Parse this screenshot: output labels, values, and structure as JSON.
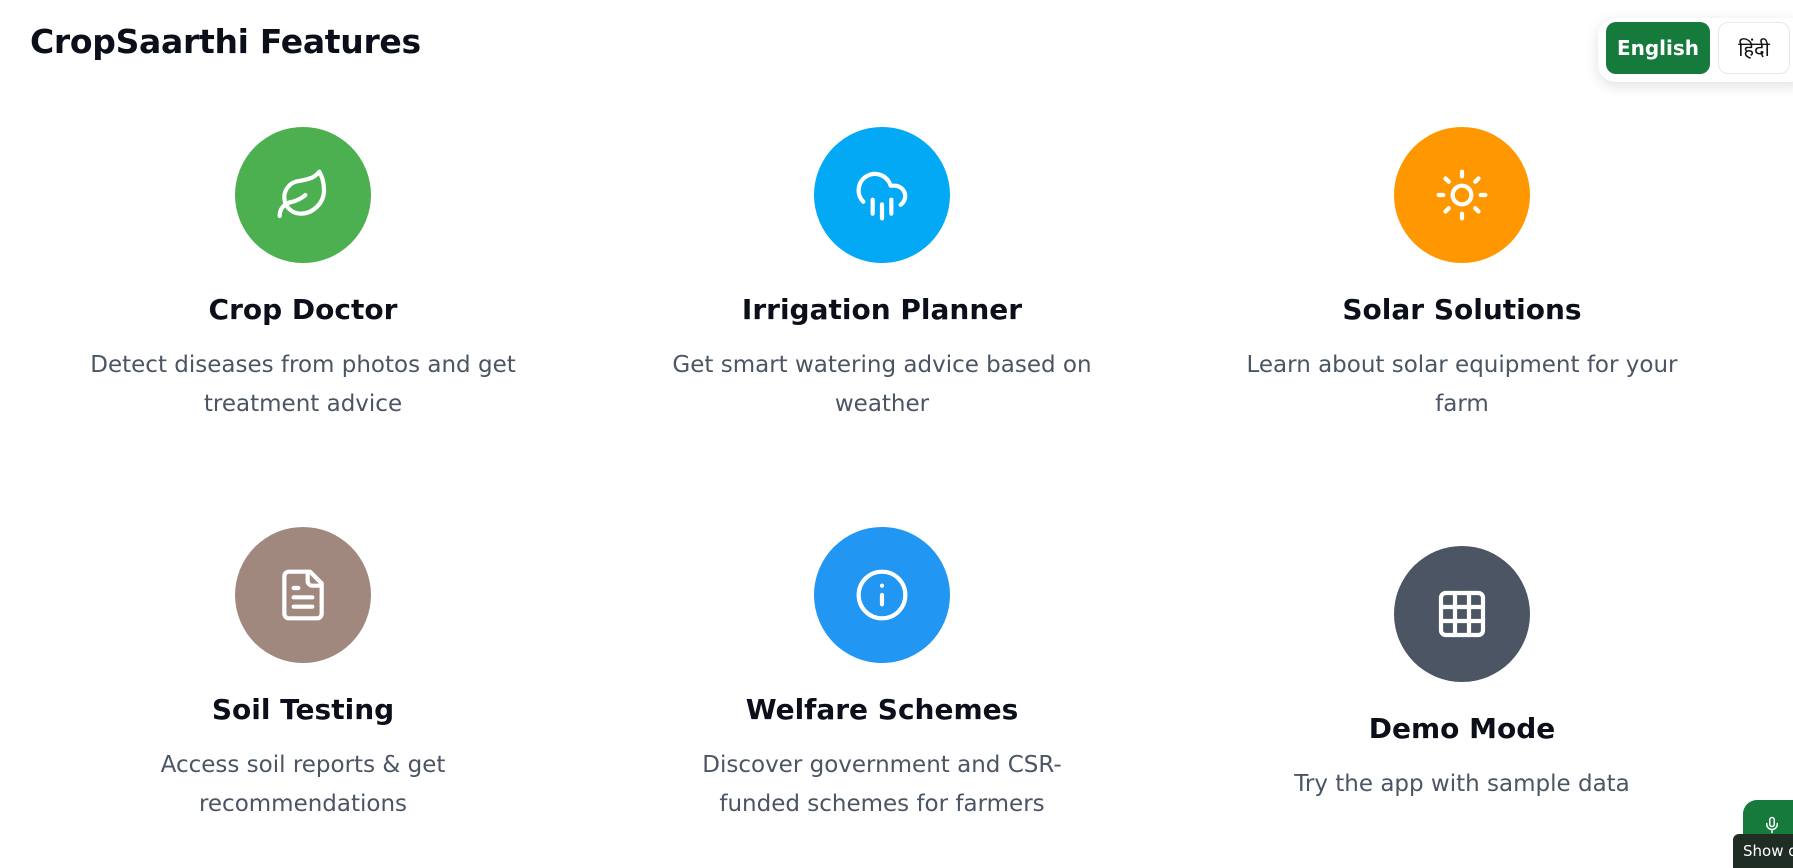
{
  "header": {
    "title": "CropSaarthi Features"
  },
  "language": {
    "english_label": "English",
    "hindi_label": "हिंदी"
  },
  "features": [
    {
      "title": "Crop Doctor",
      "description": "Detect diseases from photos and get treatment advice",
      "icon": "leaf-icon",
      "color": "#4caf50"
    },
    {
      "title": "Irrigation Planner",
      "description": "Get smart watering advice based on weather",
      "icon": "cloud-rain-icon",
      "color": "#03a9f4"
    },
    {
      "title": "Solar Solutions",
      "description": "Learn about solar equipment for your farm",
      "icon": "sun-icon",
      "color": "#ff9800"
    },
    {
      "title": "Soil Testing",
      "description": "Access soil reports & get recommendations",
      "icon": "document-icon",
      "color": "#a1887f"
    },
    {
      "title": "Welfare Schemes",
      "description": "Discover government and CSR-funded schemes for farmers",
      "icon": "info-icon",
      "color": "#2196f3"
    },
    {
      "title": "Demo Mode",
      "description": "Try the app with sample data",
      "icon": "grid-icon",
      "color": "#4b5563"
    }
  ],
  "assistant": {
    "tooltip": "Show d",
    "icon": "microphone-icon"
  }
}
